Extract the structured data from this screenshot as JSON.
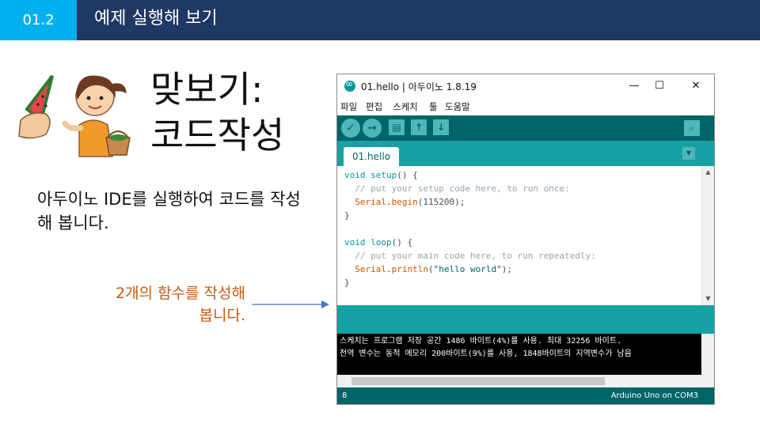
{
  "header": {
    "number": "01.2",
    "title": "예제 실행해 보기"
  },
  "slide": {
    "big_title": "맞보기:\n코드작성",
    "description": "아두이노 IDE를 실행하여 코드를 작성해 봅니다.",
    "note": "2개의 함수를 작성해\n봅니다."
  },
  "ide": {
    "window_title": "01.hello | 아두이노 1.8.19",
    "window_controls": [
      "—",
      "☐",
      "✕"
    ],
    "menu": [
      "파일",
      "편집",
      "스케치",
      "툴",
      "도움말"
    ],
    "tab_label": "01.hello",
    "code": {
      "l1_kw": "void",
      "l1_fn": "setup",
      "l1_rest": "() {",
      "l2": "  // put your setup code here, to run once:",
      "l3_obj": "Serial",
      "l3_fn": "begin",
      "l3_rest": "(115200);",
      "l4": "}",
      "l6_kw": "void",
      "l6_fn": "loop",
      "l6_rest": "() {",
      "l7": "  // put your main code here, to run repeatedly:",
      "l8_obj": "Serial",
      "l8_fn": "println",
      "l8_open": "(",
      "l8_str": "\"hello world\"",
      "l8_close": ");",
      "l9": "}"
    },
    "console": [
      "스케치는 프로그램 저장 공간 1486 바이트(4%)를 사용. 최대 32256 바이트.",
      "전역 변수는 동적 메모리 200바이트(9%)를 사용, 1848바이트의 지역변수가 남음"
    ],
    "status_line": "8",
    "status_board": "Arduino Uno on COM3"
  },
  "colors": {
    "header_bg": "#1f3864",
    "header_num_bg": "#00b0f0",
    "note": "#c55a11",
    "arduino_teal": "#00979c"
  },
  "icons": [
    "verify-icon",
    "upload-icon",
    "new-icon",
    "open-icon",
    "save-icon",
    "serial-monitor-icon",
    "tab-menu-icon",
    "arduino-logo-icon"
  ]
}
